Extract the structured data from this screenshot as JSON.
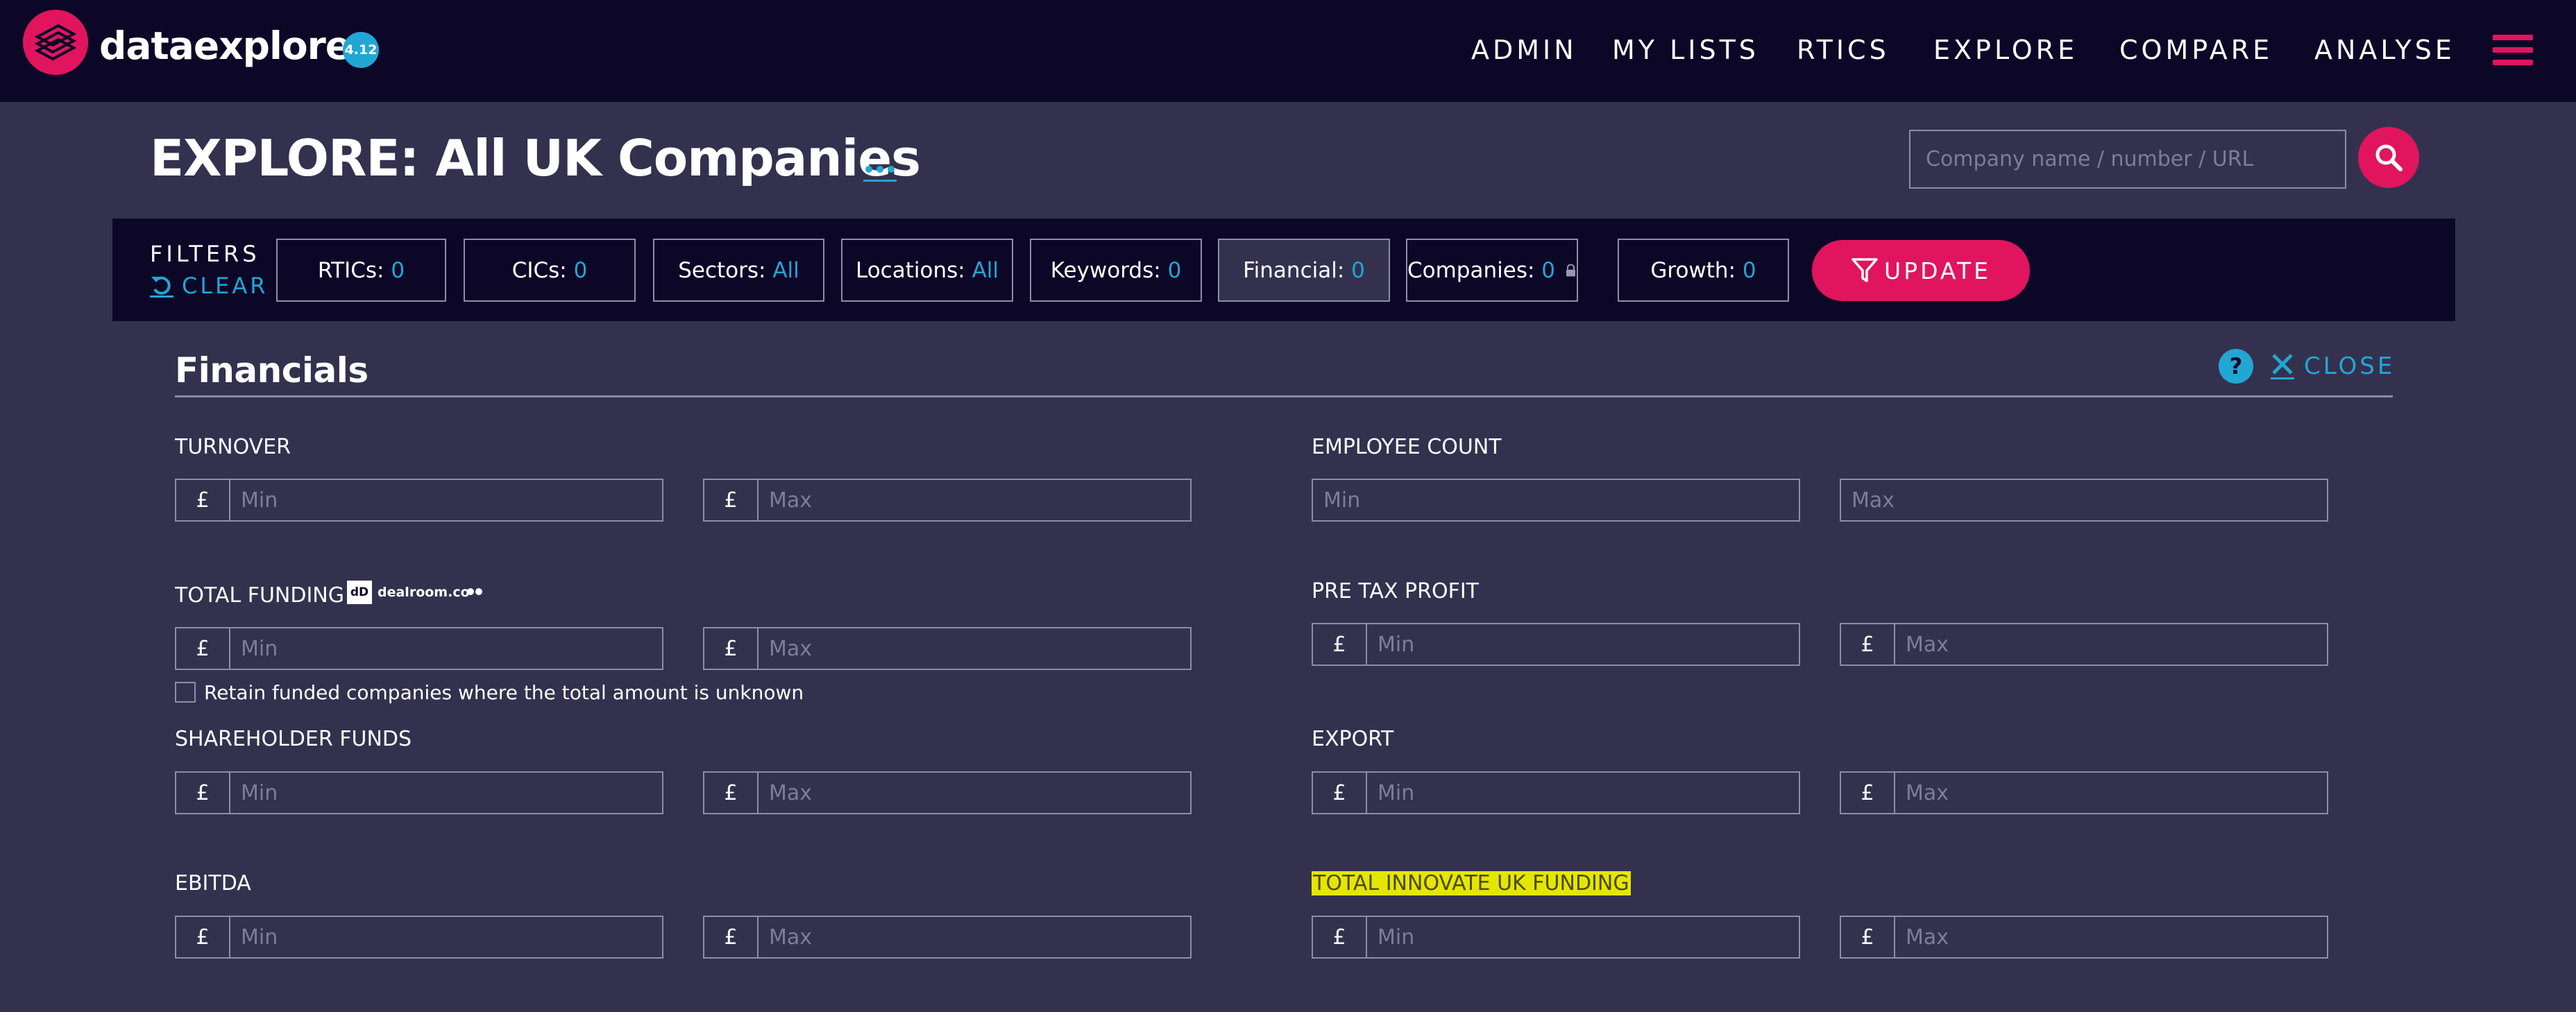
{
  "app": {
    "brand": "dataexplorer",
    "version": "4.12"
  },
  "nav": {
    "items": [
      "ADMIN",
      "MY LISTS",
      "RTICS",
      "EXPLORE",
      "COMPARE",
      "ANALYSE"
    ]
  },
  "header": {
    "title": "EXPLORE: All UK Companies",
    "search_placeholder": "Company name / number / URL"
  },
  "filters": {
    "label": "FILTERS",
    "clear_label": "CLEAR",
    "chips": [
      {
        "name": "RTICs:",
        "value": "0"
      },
      {
        "name": "CICs:",
        "value": "0"
      },
      {
        "name": "Sectors:",
        "value": "All"
      },
      {
        "name": "Locations:",
        "value": "All"
      },
      {
        "name": "Keywords:",
        "value": "0"
      },
      {
        "name": "Financial:",
        "value": "0"
      },
      {
        "name": "Companies:",
        "value": "0"
      },
      {
        "name": "Growth:",
        "value": "0"
      }
    ],
    "update_label": "UPDATE"
  },
  "panel": {
    "title": "Financials",
    "close_label": "CLOSE",
    "help_glyph": "?",
    "currency": "£",
    "min_placeholder": "Min",
    "max_placeholder": "Max",
    "fields": {
      "turnover": "TURNOVER",
      "employee_count": "EMPLOYEE COUNT",
      "total_funding": "TOTAL FUNDING",
      "pre_tax_profit": "PRE TAX PROFIT",
      "shareholder_funds": "SHAREHOLDER FUNDS",
      "export": "EXPORT",
      "ebitda": "EBITDA",
      "total_innovate_uk_funding": "TOTAL INNOVATE UK FUNDING"
    },
    "dealroom_text": "dealroom.co",
    "dealroom_mark": "dD",
    "retain_label": "Retain funded companies where the total amount is unknown"
  },
  "colors": {
    "page_bg": "#34314f",
    "bar_bg": "#0c0727",
    "accent": "#e0155e",
    "link": "#22a6d4",
    "highlight": "#e5e600"
  },
  "icons": {
    "logo": "stacked-books-logo",
    "menu": "hamburger-icon",
    "search": "search-icon",
    "clear": "undo-icon",
    "update": "filter-funnel-icon",
    "help": "help-icon",
    "close": "close-icon",
    "lock": "lock-icon",
    "more": "ellipsis-icon"
  }
}
